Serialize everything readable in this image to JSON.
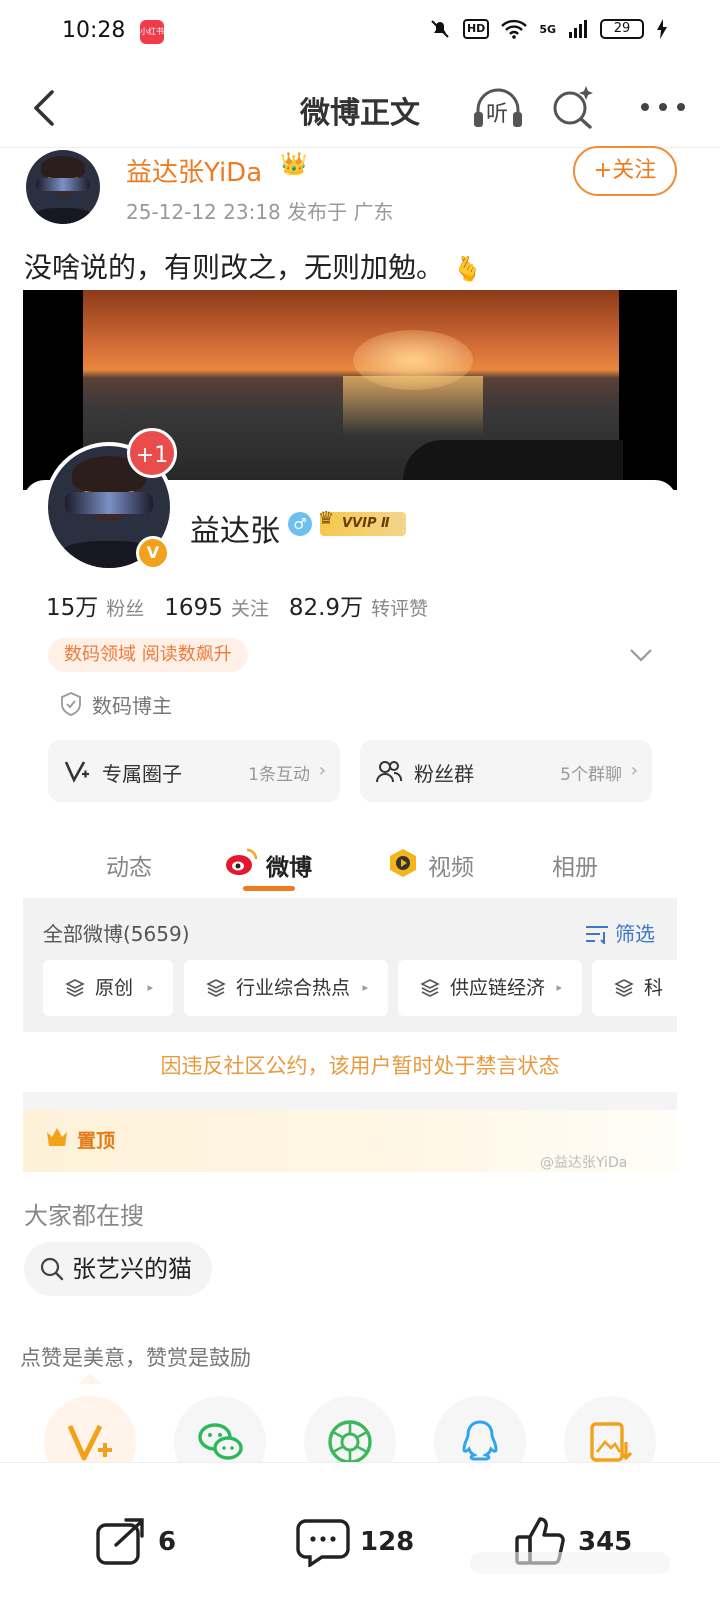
{
  "status_bar": {
    "time": "10:28",
    "app_badge": "小红书",
    "network": "HD",
    "signal": "5G",
    "battery": "29"
  },
  "nav": {
    "title": "微博正文",
    "listen_label": "听"
  },
  "post": {
    "author": "益达张YiDa",
    "meta": "25-12-12 23:18   发布于 广东",
    "follow_label": "+关注",
    "text": "没啥说的，有则改之，无则加勉。",
    "emoji": "🫰"
  },
  "profile": {
    "plus_badge": "+1",
    "name": "益达张",
    "gender_symbol": "♂",
    "vvip": "VVIP Ⅱ",
    "verified_symbol": "V",
    "stats": [
      {
        "num": "15万",
        "label": "粉丝"
      },
      {
        "num": "1695",
        "label": "关注"
      },
      {
        "num": "82.9万",
        "label": "转评赞"
      }
    ],
    "tag": "数码领域 阅读数飙升",
    "blogger_label": "数码博主",
    "circle": {
      "label": "专属圈子",
      "sub": "1条互动"
    },
    "fans_group": {
      "label": "粉丝群",
      "sub": "5个群聊"
    }
  },
  "tabs": [
    {
      "label": "动态"
    },
    {
      "label": "微博"
    },
    {
      "label": "视频"
    },
    {
      "label": "相册"
    }
  ],
  "filter": {
    "title": "全部微博(5659)",
    "filter_label": "筛选",
    "chips": [
      "原创",
      "行业综合热点",
      "供应链经济",
      "科技"
    ]
  },
  "ban_notice": "因违反社区公约，该用户暂时处于禁言状态",
  "pinned_label": "置顶",
  "watermark": "@益达张YiDa",
  "search": {
    "heading": "大家都在搜",
    "query": "张艺兴的猫"
  },
  "reward": {
    "text": "点赞是美意，赞赏是鼓励"
  },
  "actions": {
    "share_count": "6",
    "comment_count": "128",
    "like_count": "345"
  },
  "colors": {
    "accent": "#f07a1e",
    "weibo_red": "#e6162d",
    "link_blue": "#3d78c8",
    "notice": "#e89a3e"
  }
}
